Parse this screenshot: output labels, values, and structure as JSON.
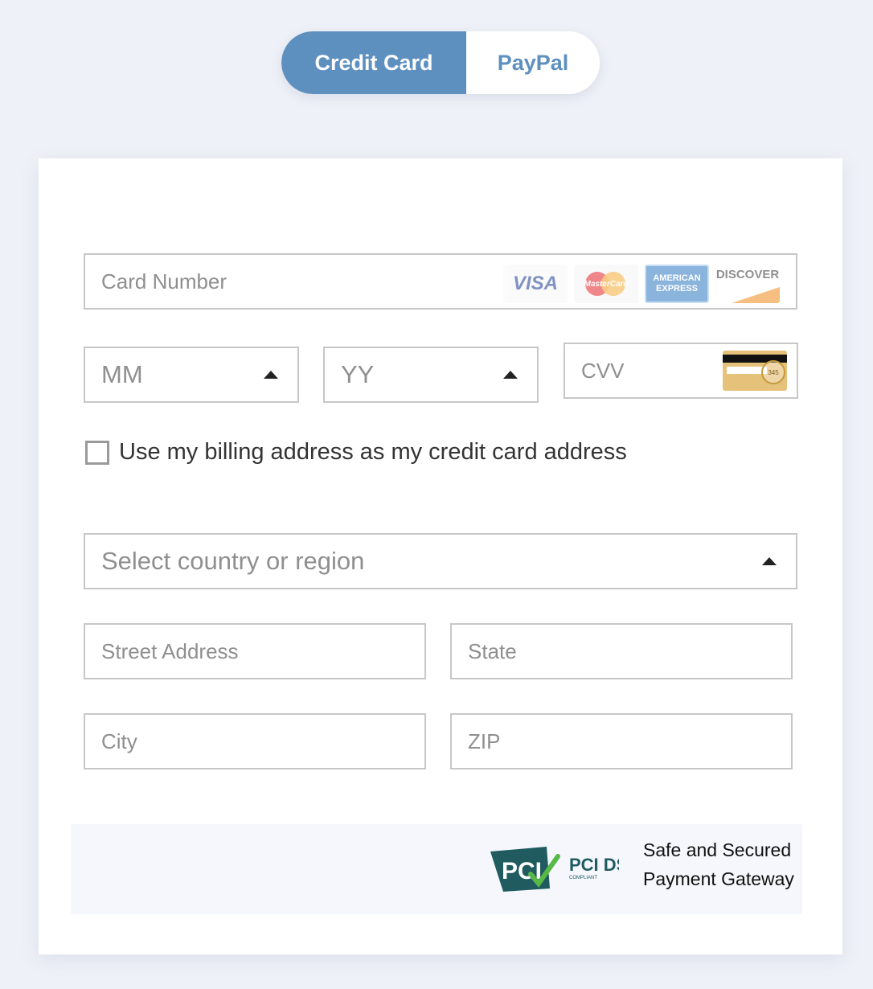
{
  "tabs": [
    {
      "label": "Credit Card",
      "active": true
    },
    {
      "label": "PayPal",
      "active": false
    }
  ],
  "colors": {
    "accent": "#5e90bf",
    "page_background": "#eef1f7",
    "field_border": "#c7c7c7",
    "placeholder": "#8f8f8f"
  },
  "form": {
    "card_number_placeholder": "Card Number",
    "card_logos": [
      "VISA",
      "MasterCard",
      "AMERICAN EXPRESS",
      "DISCOVER"
    ],
    "month_placeholder": "MM",
    "year_placeholder": "YY",
    "cvv_placeholder": "CVV",
    "cvv_hint": "345",
    "billing_checkbox_label": "Use my billing address as my credit card address",
    "billing_checkbox_checked": false,
    "country_placeholder": "Select country or region",
    "street_placeholder": "Street Address",
    "state_placeholder": "State",
    "city_placeholder": "City",
    "zip_placeholder": "ZIP"
  },
  "footer": {
    "badge_name": "PCI DSS",
    "badge_sub": "COMPLIANT",
    "secure_line1": "Safe and Secured",
    "secure_line2": "Payment Gateway"
  }
}
